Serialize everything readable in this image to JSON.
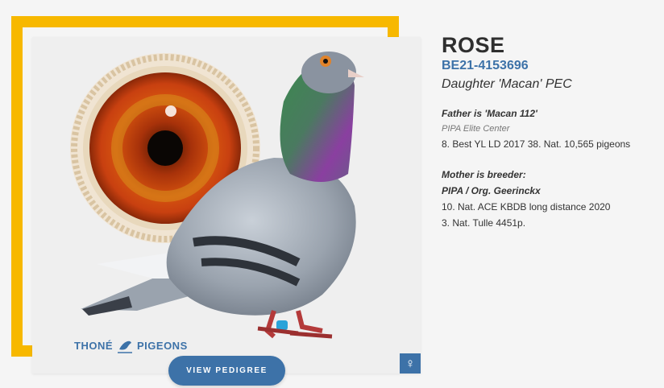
{
  "bird": {
    "name": "ROSE",
    "ring": "BE21-4153696",
    "subtitle": "Daughter 'Macan' PEC",
    "gender_symbol": "♀"
  },
  "father": {
    "heading": "Father is 'Macan 112'",
    "sub": "PIPA Elite Center",
    "results": [
      "8. Best YL LD 2017 38. Nat. 10,565 pigeons"
    ]
  },
  "mother": {
    "heading": "Mother is breeder:",
    "heading2": "PIPA / Org. Geerinckx",
    "results": [
      "10. Nat. ACE KBDB long distance 2020",
      "3. Nat. Tulle 4451p."
    ]
  },
  "logo": {
    "left": "THONÉ",
    "right": "PIGEONS"
  },
  "actions": {
    "pedigree": "VIEW PEDIGREE"
  },
  "colors": {
    "accent": "#3d72a8",
    "frame": "#f7b800"
  }
}
